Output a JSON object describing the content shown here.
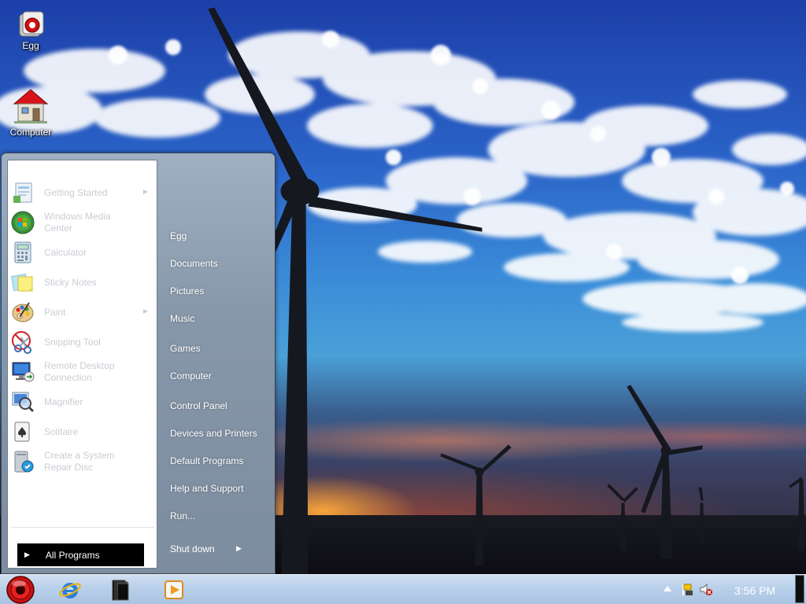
{
  "desktop": {
    "icons": [
      {
        "label": "Egg",
        "icon": "egg-app-icon"
      },
      {
        "label": "Computer",
        "icon": "computer-house-icon"
      }
    ]
  },
  "start_menu": {
    "programs": [
      {
        "label": "Getting Started",
        "icon": "getting-started-icon",
        "has_submenu": true
      },
      {
        "label": "Windows Media Center",
        "icon": "windows-media-center-icon",
        "has_submenu": false
      },
      {
        "label": "Calculator",
        "icon": "calculator-icon",
        "has_submenu": false
      },
      {
        "label": "Sticky Notes",
        "icon": "sticky-notes-icon",
        "has_submenu": false
      },
      {
        "label": "Paint",
        "icon": "paint-palette-icon",
        "has_submenu": true
      },
      {
        "label": "Snipping Tool",
        "icon": "snipping-tool-icon",
        "has_submenu": false
      },
      {
        "label": "Remote Desktop Connection",
        "icon": "remote-desktop-icon",
        "has_submenu": false
      },
      {
        "label": "Magnifier",
        "icon": "magnifier-icon",
        "has_submenu": false
      },
      {
        "label": "Solitaire",
        "icon": "solitaire-icon",
        "has_submenu": false
      },
      {
        "label": "Create a System Repair Disc",
        "icon": "repair-disc-icon",
        "has_submenu": false
      }
    ],
    "all_programs": "All Programs",
    "places": [
      {
        "label": "Egg"
      },
      {
        "label": "Documents"
      },
      {
        "label": "Pictures"
      },
      {
        "label": "Music"
      },
      {
        "label": "Games"
      },
      {
        "label": "Computer"
      },
      {
        "label": "Control Panel"
      },
      {
        "label": "Devices and Printers"
      },
      {
        "label": "Default Programs"
      },
      {
        "label": "Help and Support"
      },
      {
        "label": "Run..."
      }
    ],
    "shutdown_label": "Shut down"
  },
  "taskbar": {
    "start_icon": "start-orb-icon",
    "pinned": [
      {
        "icon": "internet-explorer-icon"
      },
      {
        "icon": "libraries-folder-icon"
      },
      {
        "icon": "media-player-icon"
      }
    ],
    "tray": {
      "icons": [
        "show-hidden-icons-icon",
        "action-center-flag-icon",
        "volume-muted-icon"
      ],
      "clock": "3:56 PM"
    }
  },
  "colors": {
    "taskbar": "#b9d0ea",
    "menu_right_pane": "#8797aa",
    "all_programs_bg": "#000000",
    "disabled_text": "#c9cdd3"
  }
}
